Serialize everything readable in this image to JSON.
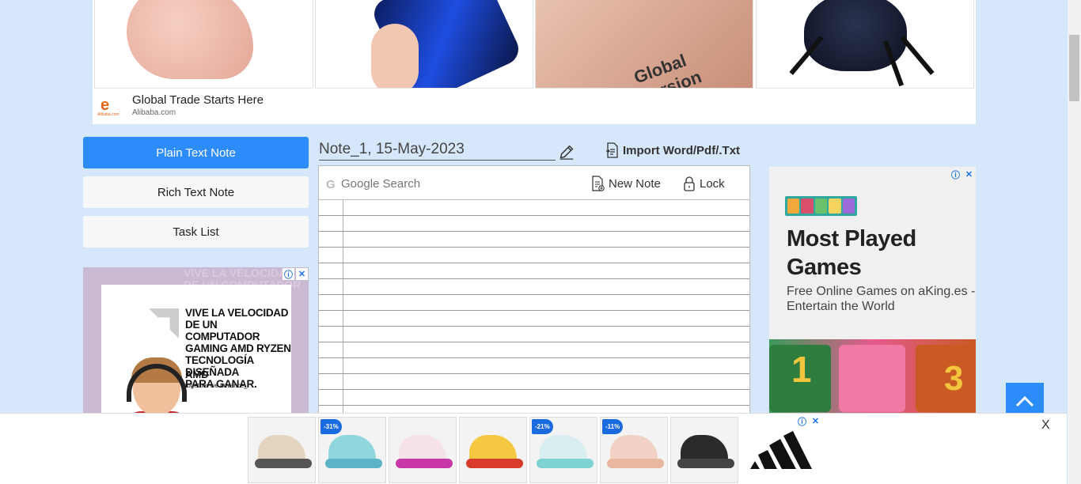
{
  "top_ad": {
    "title": "Global Trade Starts Here",
    "domain": "Alibaba.com",
    "logo_letter": "e",
    "logo_sub": "Alibaba.com",
    "product_text": "Global Version"
  },
  "nav": {
    "plain_label": "Plain Text Note",
    "rich_label": "Rich Text Note",
    "task_label": "Task List",
    "active": "Plain Text Note"
  },
  "left_ad": {
    "bg_text": "VIVE LA VELOCIDAD DE UN COMPUTADOR",
    "headline_lines": [
      "VIVE LA VELOCIDAD",
      "DE UN COMPUTADOR",
      "GAMING AMD RYZEN",
      "TECNOLOGÍA DISEÑADA",
      "PARA GANAR."
    ],
    "brand": "AMD",
    "tagline": "together we advance_"
  },
  "note": {
    "title": "Note_1, 15-May-2023",
    "import_label": "Import Word/Pdf/.Txt",
    "search_glyph": "G",
    "search_placeholder": "Google Search",
    "new_note_label": "New Note",
    "lock_label": "Lock"
  },
  "right_ad": {
    "title": "Most Played Games",
    "description": "Free Online Games on aKing.es - Entertain the World",
    "game_number_1": "1",
    "game_number_3": "3"
  },
  "bottom_ad": {
    "badges": [
      "-31%",
      "-21%",
      "-11%"
    ],
    "close_label": "X"
  },
  "adchoices": {
    "info": "ⓘ",
    "close": "✕"
  },
  "colors": {
    "page_bg": "#d6e7fb",
    "accent": "#2c8cfa"
  }
}
